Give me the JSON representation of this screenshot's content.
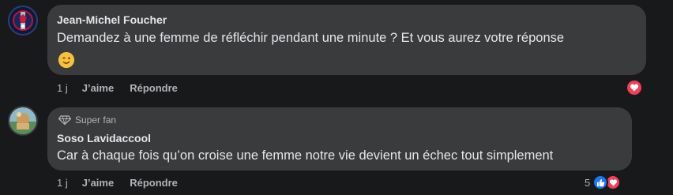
{
  "comments": [
    {
      "author": "Jean-Michel Foucher",
      "text": "Demandez à une femme de réfléchir pendant une minute ? Et vous aurez votre réponse",
      "emoji": "winking-face",
      "time": "1 j",
      "like_label": "J’aime",
      "reply_label": "Répondre",
      "reaction": {
        "type": "love",
        "color": "#f33e58"
      }
    },
    {
      "badge": "Super fan",
      "author": "Soso Lavidaccool",
      "text": "Car à chaque fois qu’on croise une femme notre vie devient un échec tout simplement",
      "time": "1 j",
      "like_label": "J’aime",
      "reply_label": "Répondre",
      "reaction": {
        "count": "5",
        "types": [
          "like",
          "love"
        ],
        "like_color": "#1877f2",
        "love_color": "#f33e58"
      }
    }
  ],
  "colors": {
    "background": "#18191a",
    "bubble": "#3a3b3c",
    "primary_text": "#e4e6eb",
    "secondary_text": "#b0b3b8"
  }
}
